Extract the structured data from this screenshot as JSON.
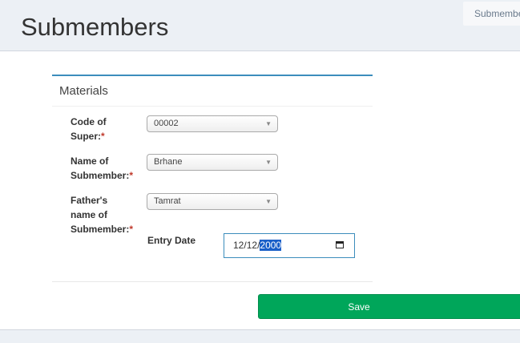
{
  "header": {
    "title": "Submembers",
    "breadcrumb": "Submembers"
  },
  "box": {
    "title": "Materials"
  },
  "form": {
    "code_of_super": {
      "label_line1": "Code of",
      "label_line2": "Super:",
      "required": "*",
      "value": "00002"
    },
    "name_of_submember": {
      "label_line1": "Name of",
      "label_line2": "Submember:",
      "required": "*",
      "value": "Brhane"
    },
    "fathers_name": {
      "label_line1": "Father's",
      "label_line2": "name of",
      "label_line3": "Submember:",
      "required": "*",
      "value": "Tamrat"
    },
    "entry_date": {
      "label": "Entry Date",
      "month": "12",
      "day": "12",
      "year": "2000"
    }
  },
  "actions": {
    "save_label": "Save"
  },
  "colors": {
    "accent": "#3c8dbc",
    "save": "#00a65a",
    "required": "#c0392b",
    "selection": "#1a5fc8"
  },
  "icons": {
    "select_caret": "caret-down-icon",
    "calendar": "calendar-icon"
  }
}
